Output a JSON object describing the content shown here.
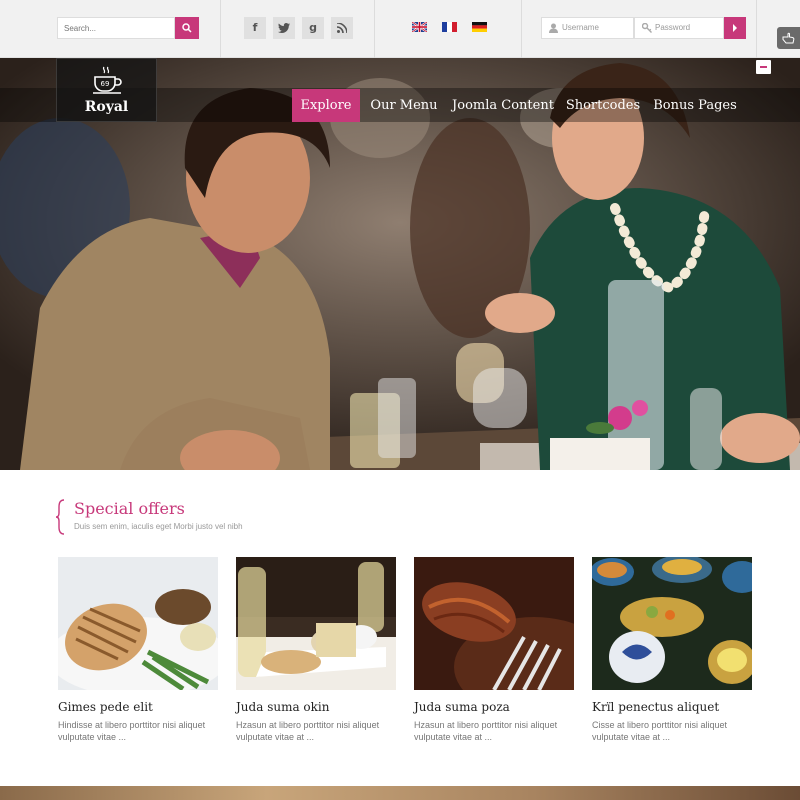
{
  "topbar": {
    "search_placeholder": "Search...",
    "social": [
      "f",
      "t",
      "g",
      "rss"
    ],
    "languages": [
      "English",
      "Français",
      "Deutsch"
    ],
    "username_placeholder": "Username",
    "password_placeholder": "Password"
  },
  "hero": {
    "logo_number": "69",
    "logo_text": "Royal",
    "nav": [
      {
        "label": "Explore",
        "active": true
      },
      {
        "label": "Our Menu",
        "active": false
      },
      {
        "label": "Joomla Content",
        "active": false
      },
      {
        "label": "Shortcodes",
        "active": false
      },
      {
        "label": "Bonus Pages",
        "active": false
      }
    ]
  },
  "offers": {
    "title": "Special offers",
    "subtitle": "Duis sem enim, iaculis eget Morbi justo vel nibh",
    "cards": [
      {
        "title": "Gimes pede elit",
        "desc": "Hindisse at libero porttitor nisi aliquet vulputate vitae ..."
      },
      {
        "title": "Juda suma okin",
        "desc": "Hzasun at libero porttitor nisi aliquet vulputate vitae at ..."
      },
      {
        "title": "Juda suma poza",
        "desc": "Hzasun at libero porttitor nisi aliquet vulputate vitae at ..."
      },
      {
        "title": "Krïl penectus aliquet",
        "desc": "Cisse at libero porttitor nisi aliquet vulputate vitae at ..."
      }
    ]
  },
  "colors": {
    "accent": "#c7387a",
    "topbar": "#f1f1f1"
  }
}
